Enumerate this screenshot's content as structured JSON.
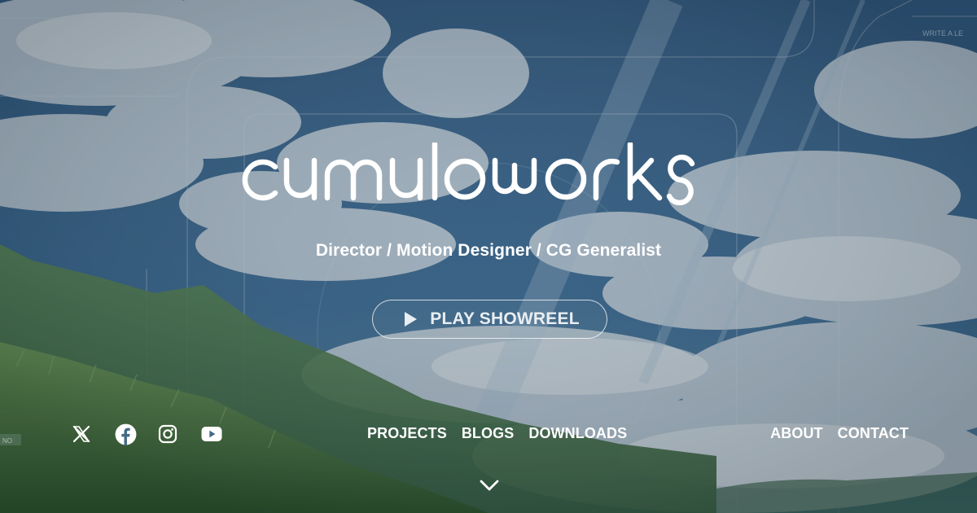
{
  "brand": {
    "logo_text": "cumuloworks"
  },
  "hero": {
    "tagline": "Director / Motion Designer / CG Generalist",
    "play_button_label": "PLAY SHOWREEL"
  },
  "social": [
    {
      "name": "x-icon"
    },
    {
      "name": "facebook-icon"
    },
    {
      "name": "instagram-icon"
    },
    {
      "name": "youtube-icon"
    }
  ],
  "nav": {
    "center": [
      {
        "label": "PROJECTS"
      },
      {
        "label": "BLOGS"
      },
      {
        "label": "DOWNLOADS"
      }
    ],
    "right": [
      {
        "label": "ABOUT"
      },
      {
        "label": "CONTACT"
      }
    ]
  },
  "background_overlay_text": {
    "top_right": "WRITE A LE",
    "left_badge": "NO"
  },
  "colors": {
    "sky": "#3b6a93",
    "cloud": "#c9d7df",
    "grass": "#4d7d3c",
    "text": "#ffffff"
  }
}
